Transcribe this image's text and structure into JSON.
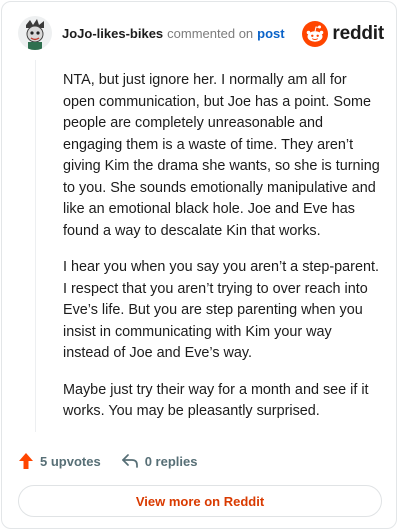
{
  "header": {
    "username": "JoJo-likes-bikes",
    "action_text": "commented on",
    "post_link": "post",
    "brand_name": "reddit"
  },
  "comment": {
    "paragraphs": [
      "NTA, but just ignore her. I normally am all for open communication, but Joe has a point. Some people are completely unreasonable and engaging them is a waste of time. They aren’t giving Kim the drama she wants, so she is turning to you. She sounds emotionally manipulative and like an emotional black hole. Joe and Eve has found a way to descalate Kin that works.",
      "I hear you when you say you aren’t a step-parent. I respect that you aren’t trying to over reach into Eve’s life. But you are step parenting when you insist in communicating with Kim your way instead of Joe and Eve’s way.",
      "Maybe just try their way for a month and see if it works. You may be pleasantly surprised."
    ]
  },
  "actions": {
    "upvotes": "5 upvotes",
    "replies": "0 replies"
  },
  "footer": {
    "view_more": "View more on Reddit"
  },
  "colors": {
    "brand_orange": "#ff4500",
    "upvote_orange": "#ff4500",
    "link_blue": "#0a63c9",
    "cta_text": "#d93a00"
  },
  "icons": {
    "avatar": "user-avatar-icon",
    "brand": "reddit-logo-icon",
    "upvote": "upvote-arrow-icon",
    "reply": "reply-arrow-icon"
  }
}
